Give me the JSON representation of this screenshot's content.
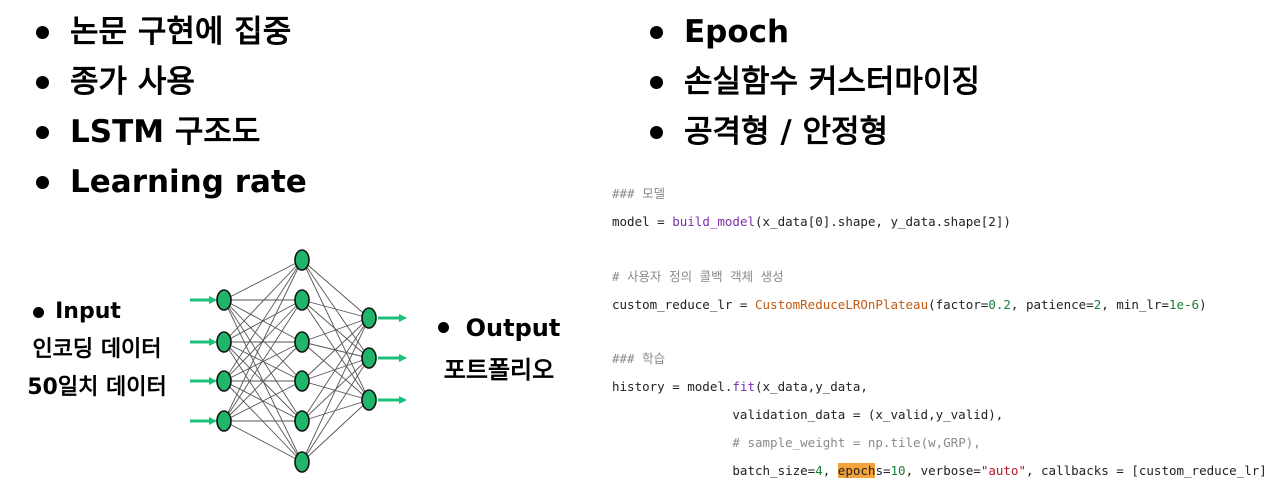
{
  "left_bullets": [
    "논문 구현에 집중",
    "종가 사용",
    "LSTM 구조도",
    "Learning rate"
  ],
  "right_bullets": [
    "Epoch",
    "손실함수 커스터마이징",
    "공격형 / 안정형"
  ],
  "diagram": {
    "input_lines": [
      "Input",
      "인코딩 데이터",
      "50일치 데이터"
    ],
    "output_lines": [
      "Output",
      "포트폴리오"
    ],
    "node_fill": "#1fb56a",
    "arrow_color": "#19c17a"
  },
  "code": {
    "model_comment": "### 모델",
    "callback_comment": "# 사용자 정의 콜백 객체 생성",
    "train_comment": "### 학습",
    "build_fn": "build_model",
    "build_args": "(x_data[0].shape, y_data.shape[2])",
    "cb_class": "CustomReduceLROnPlateau",
    "fit_sample_comment": "# sample_weight = np.tile(w,GRP),"
  }
}
